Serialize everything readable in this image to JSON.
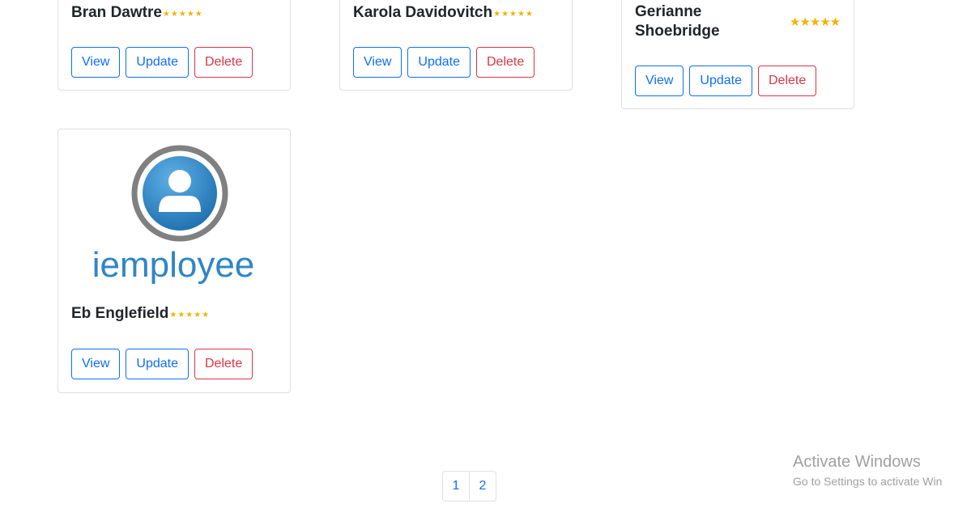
{
  "cards": [
    {
      "name": "Bran Dawtre",
      "stars": "★★★★★",
      "view": "View",
      "update": "Update",
      "delete": "Delete"
    },
    {
      "name": "Karola Davidovitch",
      "stars": "★★★★★",
      "view": "View",
      "update": "Update",
      "delete": "Delete"
    },
    {
      "name_line1": "Gerianne",
      "name_line2": "Shoebridge",
      "stars": "★★★★★",
      "view": "View",
      "update": "Update",
      "delete": "Delete"
    },
    {
      "name": "Eb Englefield",
      "stars": "★★★★★",
      "view": "View",
      "update": "Update",
      "delete": "Delete",
      "logo_text": "iemployee"
    }
  ],
  "pagination": [
    "1",
    "2"
  ],
  "watermark": {
    "title": "Activate Windows",
    "subtitle": "Go to Settings to activate Win"
  },
  "colors": {
    "primary": "#0d6efd",
    "danger": "#dc3545",
    "star": "#f5b301",
    "logo_blue": "#2f86c6",
    "logo_ring": "#808080"
  }
}
